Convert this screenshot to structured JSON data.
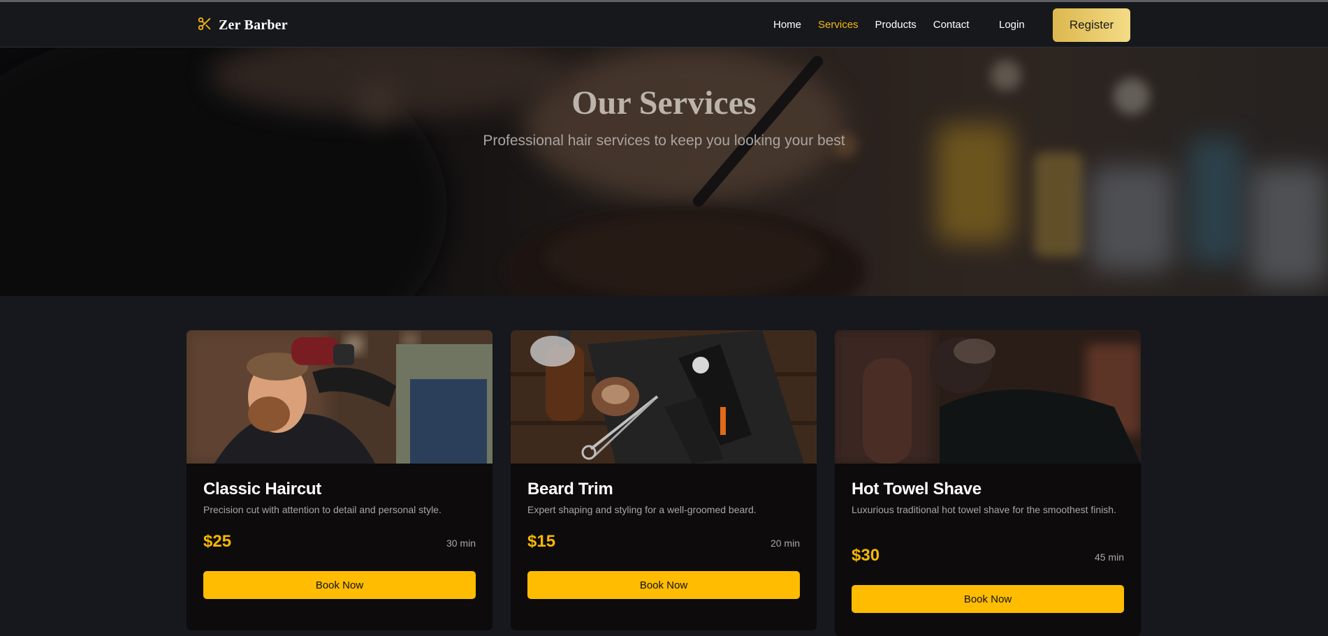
{
  "colors": {
    "accent": "#f5b80f",
    "button": "#ffbc00",
    "background": "#16181d",
    "card": "#0d0b0b"
  },
  "navbar": {
    "brand": "Zer Barber",
    "brand_icon": "scissors-icon",
    "links": [
      "Home",
      "Services",
      "Products",
      "Contact"
    ],
    "active_link": "Services",
    "login": "Login",
    "register": "Register"
  },
  "hero": {
    "title": "Our Services",
    "subtitle": "Professional hair services to keep you looking your best"
  },
  "services": [
    {
      "title": "Classic Haircut",
      "description": "Precision cut with attention to detail and personal style.",
      "price": "$25",
      "duration": "30 min",
      "button": "Book Now"
    },
    {
      "title": "Beard Trim",
      "description": "Expert shaping and styling for a well-groomed beard.",
      "price": "$15",
      "duration": "20 min",
      "button": "Book Now"
    },
    {
      "title": "Hot Towel Shave",
      "description": "Luxurious traditional hot towel shave for the smoothest finish.",
      "price": "$30",
      "duration": "45 min",
      "button": "Book Now"
    }
  ]
}
